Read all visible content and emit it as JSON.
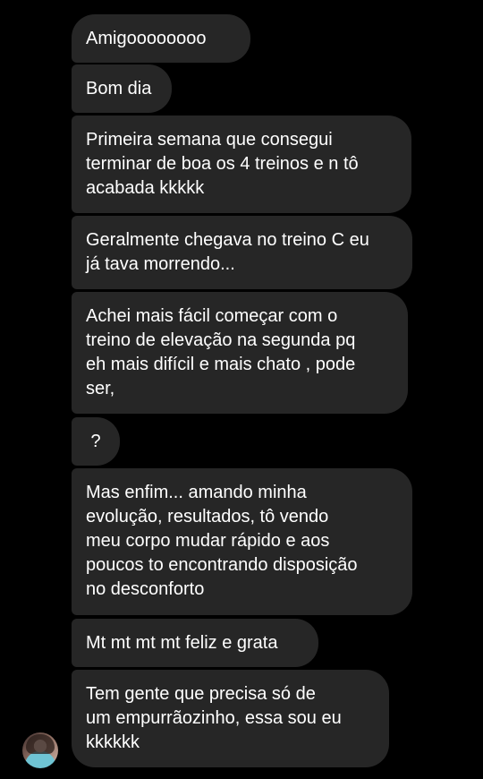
{
  "messages": [
    {
      "lines": [
        "Amigoooooooo"
      ]
    },
    {
      "lines": [
        "Bom dia"
      ]
    },
    {
      "lines": [
        "Primeira semana que consegui",
        "terminar de boa os 4 treinos e n tô",
        "acabada kkkkk"
      ]
    },
    {
      "lines": [
        "Geralmente chegava no treino C eu",
        "já tava morrendo..."
      ]
    },
    {
      "lines": [
        "Achei mais fácil começar com o",
        "treino de elevação na segunda pq",
        "eh mais difícil e mais chato , pode",
        "ser,"
      ]
    },
    {
      "lines": [
        "?"
      ]
    },
    {
      "lines": [
        "Mas enfim... amando minha",
        "evolução, resultados, tô vendo",
        "meu corpo mudar rápido e aos",
        "poucos to encontrando disposição",
        "no desconforto"
      ]
    },
    {
      "lines": [
        "Mt mt mt mt feliz e grata"
      ]
    },
    {
      "lines": [
        "Tem gente que precisa só de",
        "um empurrãozinho, essa sou eu",
        "kkkkkk"
      ]
    }
  ],
  "colors": {
    "background": "#000000",
    "bubble": "#262626",
    "text": "#ffffff"
  }
}
